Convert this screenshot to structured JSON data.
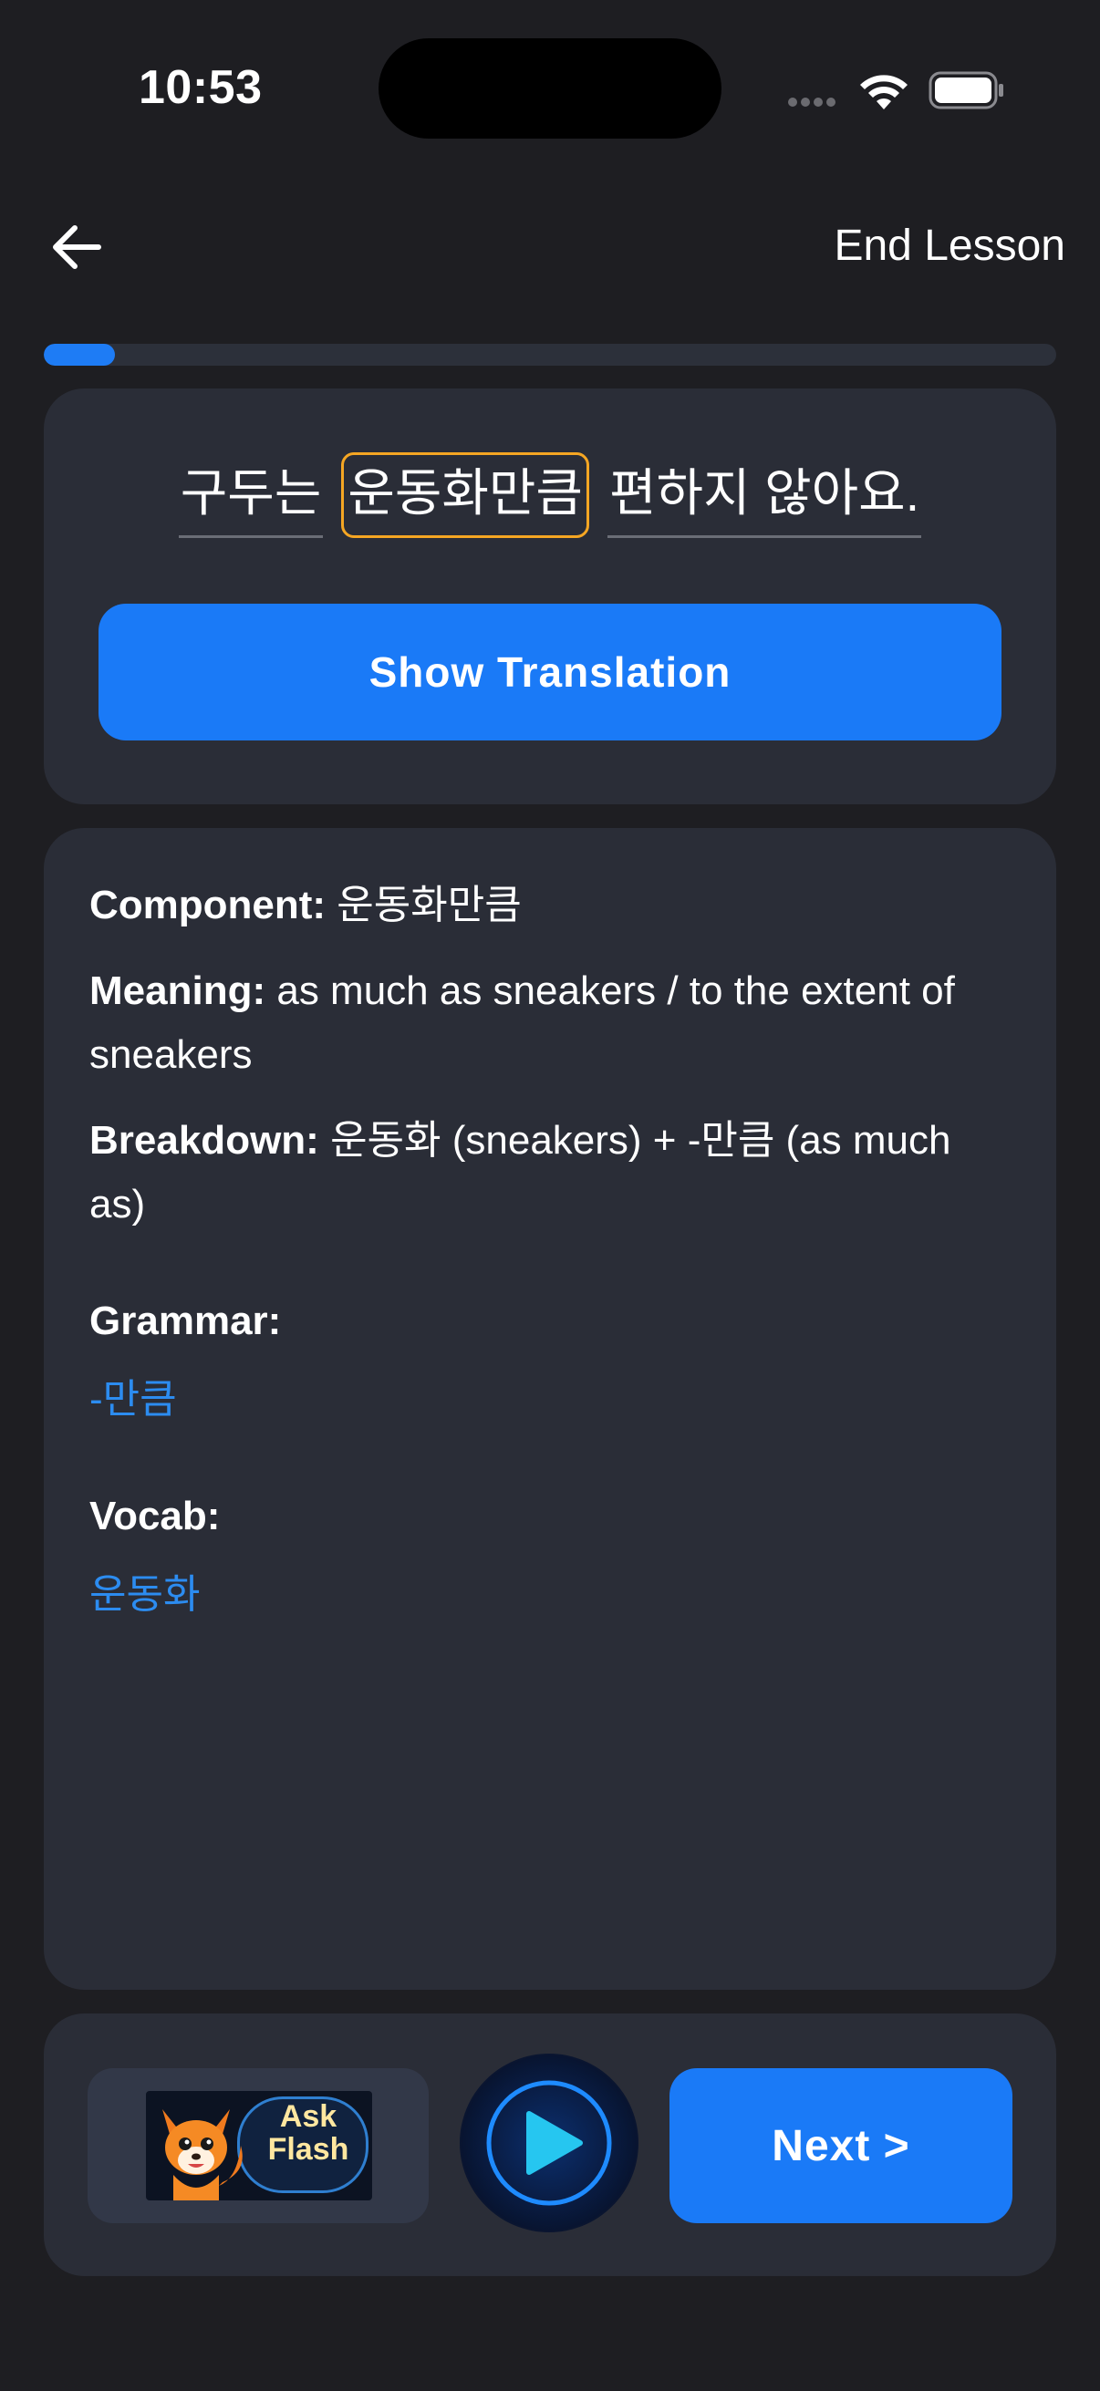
{
  "status": {
    "time": "10:53"
  },
  "nav": {
    "end_lesson_label": "End Lesson"
  },
  "progress": {
    "fraction": 0.07
  },
  "sentence": {
    "words": [
      "구두는",
      "운동화만큼",
      "편하지 않아요."
    ],
    "selected_index": 1,
    "show_translation_label": "Show Translation"
  },
  "details": {
    "component_label": "Component:",
    "component_value": "운동화만큼",
    "meaning_label": "Meaning:",
    "meaning_value": "as much as sneakers / to the extent of sneakers",
    "breakdown_label": "Breakdown:",
    "breakdown_value": "운동화 (sneakers) + -만큼 (as much as)",
    "grammar_label": "Grammar:",
    "grammar_items": [
      "-만큼"
    ],
    "vocab_label": "Vocab:",
    "vocab_items": [
      "운동화"
    ]
  },
  "bottom": {
    "ask_flash_text": "Ask Flash",
    "next_label": "Next >"
  },
  "colors": {
    "background": "#1e1e22",
    "card": "#2a2d37",
    "accent_blue": "#1a7af7",
    "link_blue": "#2c8cf0",
    "selected_outline": "#f5a623"
  }
}
